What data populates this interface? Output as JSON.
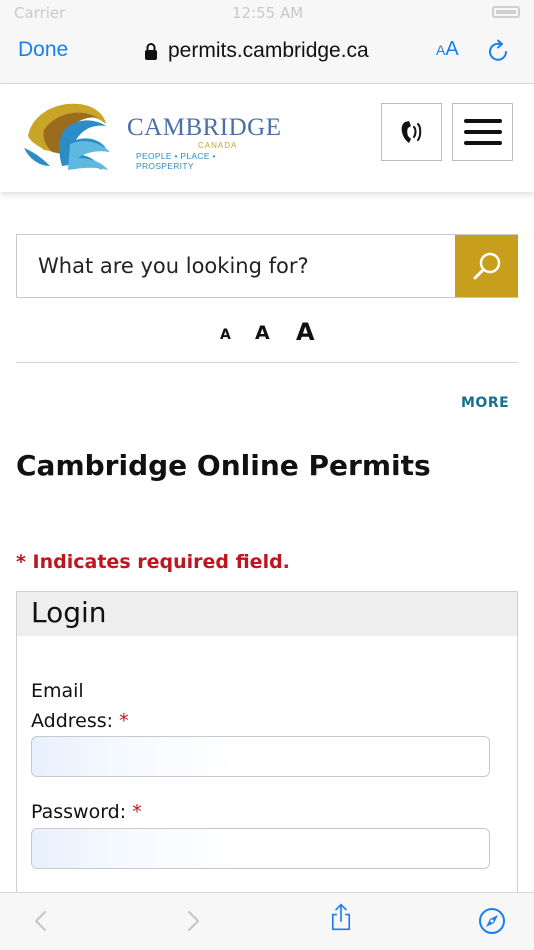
{
  "status_bar": {
    "carrier": "Carrier",
    "time": "12:55 AM"
  },
  "browser": {
    "done_label": "Done",
    "url": "permits.cambridge.ca",
    "text_size_small": "A",
    "text_size_big": "A"
  },
  "site": {
    "logo": {
      "name": "CAMBRIDGE",
      "country": "CANADA",
      "tagline": "PEOPLE • PLACE • PROSPERITY"
    }
  },
  "search": {
    "placeholder": "What are you looking for?"
  },
  "text_size": {
    "small": "A",
    "medium": "A",
    "large": "A"
  },
  "more_label": "MORE",
  "page_title": "Cambridge Online Permits",
  "required_note": "* Indicates required field.",
  "login": {
    "title": "Login",
    "email_label": "Email Address:",
    "password_label": "Password:",
    "required_mark": "*",
    "email_value": "",
    "password_value": ""
  },
  "colors": {
    "ios_blue": "#1a7ef2",
    "search_gold": "#c79f1c",
    "required_red": "#c0141e",
    "more_teal": "#1a6f8f"
  },
  "icons": [
    "lock-icon",
    "reload-icon",
    "phone-icon",
    "hamburger-menu-icon",
    "search-icon",
    "back-icon",
    "forward-icon",
    "share-icon",
    "compass-icon"
  ]
}
